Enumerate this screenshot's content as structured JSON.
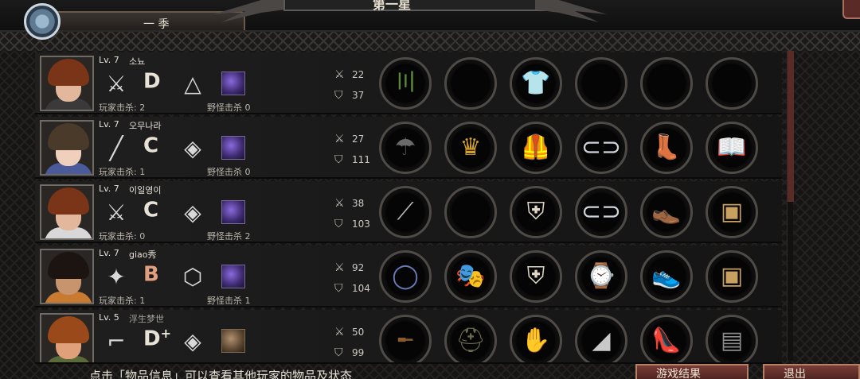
{
  "header": {
    "top_left_label": "一 季",
    "title": "第一星"
  },
  "players": [
    {
      "level": "Lv. 7",
      "name": "소뇨",
      "weapon_icon": "dual-swords-icon",
      "grade": "D",
      "grade_plus": "",
      "trait_icon": "triangle-emblem-icon",
      "skill_icon": "purple-crystal-skill-icon",
      "player_kills": "玩家击杀: 2",
      "monster_kills": "野怪击杀 0",
      "attack": "22",
      "defense": "37",
      "equipment": [
        "bamboo-icon",
        "empty-slot",
        "shirt-icon",
        "empty-slot",
        "empty-slot",
        "empty-slot"
      ]
    },
    {
      "level": "Lv. 7",
      "name": "오무나라",
      "weapon_icon": "bat-icon",
      "grade": "C",
      "grade_plus": "",
      "trait_icon": "diamond-emblem-icon",
      "skill_icon": "purple-crystal-skill-icon",
      "player_kills": "玩家击杀: 1",
      "monster_kills": "野怪击杀 0",
      "attack": "27",
      "defense": "111",
      "equipment": [
        "umbrella-icon",
        "crown-icon",
        "leather-vest-icon",
        "arm-guards-icon",
        "boots-icon",
        "book-icon"
      ]
    },
    {
      "level": "Lv. 7",
      "name": "이일영이",
      "weapon_icon": "dual-swords-icon",
      "grade": "C",
      "grade_plus": "",
      "trait_icon": "diamond-emblem-icon",
      "skill_icon": "purple-crystal-skill-icon",
      "player_kills": "玩家击杀: 0",
      "monster_kills": "野怪击杀 2",
      "attack": "38",
      "defense": "103",
      "equipment": [
        "needles-icon",
        "empty-slot",
        "armor-icon",
        "arm-guards-icon",
        "shoes-icon",
        "box-icon"
      ]
    },
    {
      "level": "Lv. 7",
      "name": "giao秀",
      "weapon_icon": "shuriken-icon",
      "grade": "B",
      "grade_plus": "",
      "trait_icon": "hexagon-emblem-icon",
      "skill_icon": "purple-crystal-skill-icon",
      "player_kills": "玩家击杀: 1",
      "monster_kills": "野怪击杀 1",
      "attack": "92",
      "defense": "104",
      "equipment": [
        "ring-icon",
        "mask-icon",
        "armor-icon",
        "watch-icon",
        "sneakers-icon",
        "box-icon"
      ]
    },
    {
      "level": "Lv. 5",
      "name": "浮生梦世",
      "weapon_icon": "pistol-icon",
      "grade": "D",
      "grade_plus": "+",
      "trait_icon": "diamond-emblem-icon",
      "skill_icon": "bullets-skill-icon",
      "player_kills": "",
      "monster_kills": "",
      "attack": "50",
      "defense": "99",
      "equipment": [
        "rifle-icon",
        "helmet-icon",
        "gloves-icon",
        "shard-icon",
        "heels-icon",
        "plate-icon"
      ]
    }
  ],
  "hint_text": "点击「物品信息」可以查看其他玩家的物品及状态",
  "buttons": {
    "left": "游戏结果",
    "right": "退出"
  },
  "colors": {
    "accent_red": "#5a2b26",
    "button_border": "#b58068"
  }
}
